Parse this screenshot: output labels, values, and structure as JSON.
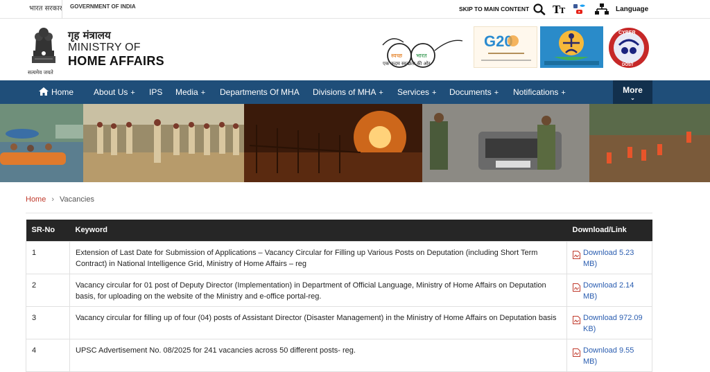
{
  "topbar": {
    "gov_hindi": "भारत सरकार",
    "gov_english": "GOVERNMENT OF INDIA",
    "skip_label": "SKIP TO MAIN CONTENT",
    "language_label": "Language"
  },
  "header": {
    "ministry_hindi": "गृह मंत्रालय",
    "ministry_line1": "MINISTRY OF",
    "ministry_line2": "HOME AFFAIRS",
    "emblem_motto": "सत्यमेव जयते",
    "swachh_word1": "स्वच्छ",
    "swachh_word2": "भारत",
    "swachh_tagline": "एक कदम स्वच्छता की ओर",
    "g20_text": "G20",
    "cyber_text": "CYBER",
    "cyber_sub": "DOST"
  },
  "nav": {
    "items": [
      {
        "label": "Home"
      },
      {
        "label": "About Us"
      },
      {
        "label": "IPS"
      },
      {
        "label": "Media"
      },
      {
        "label": "Departments Of MHA"
      },
      {
        "label": "Divisions of MHA"
      },
      {
        "label": "Services"
      },
      {
        "label": "Documents"
      },
      {
        "label": "Notifications"
      }
    ],
    "more_label": "More",
    "plus": "+"
  },
  "breadcrumb": {
    "home": "Home",
    "current": "Vacancies"
  },
  "table": {
    "headers": [
      "SR-No",
      "Keyword",
      "Download/Link"
    ],
    "rows": [
      {
        "sr": "1",
        "keyword": "Extension of Last Date for Submission of Applications – Vacancy Circular for Filling up Various Posts on Deputation (including Short Term Contract) in National Intelligence Grid, Ministry of Home Affairs – reg",
        "download": "Download 5.23 MB)"
      },
      {
        "sr": "2",
        "keyword": "Vacancy circular for 01 post of Deputy Director (Implementation) in Department of Official Language, Ministry of Home Affairs on Deputation basis, for uploading on the website of the Ministry and e-office portal-reg.",
        "download": "Download 2.14 MB)"
      },
      {
        "sr": "3",
        "keyword": "Vacancy circular for filling up of four (04) posts of Assistant Director (Disaster Management) in the Ministry of Home Affairs on Deputation basis",
        "download": "Download 972.09 KB)"
      },
      {
        "sr": "4",
        "keyword": "UPSC Advertisement No. 08/2025 for 241 vacancies across 50 different posts- reg.",
        "download": "Download 9.55 MB)"
      }
    ]
  },
  "colors": {
    "nav_bg": "#1f4e79",
    "more_bg": "#12304d",
    "table_header_bg": "#262626",
    "link": "#2a5db0",
    "breadcrumb_home": "#c0392b"
  }
}
